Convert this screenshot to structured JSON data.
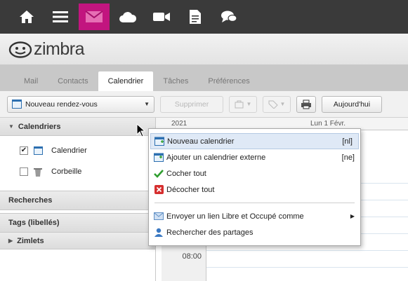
{
  "appbar": {
    "apps": [
      {
        "name": "home-icon"
      },
      {
        "name": "menu-icon"
      },
      {
        "name": "mail-icon",
        "active": true
      },
      {
        "name": "cloud-icon"
      },
      {
        "name": "video-icon"
      },
      {
        "name": "document-icon"
      },
      {
        "name": "chat-icon"
      }
    ],
    "active_color": "#c2157f",
    "bg_color": "#3a3a3a"
  },
  "logo": {
    "text": "zimbra"
  },
  "tabs": [
    {
      "label": "Mail"
    },
    {
      "label": "Contacts"
    },
    {
      "label": "Calendrier",
      "active": true
    },
    {
      "label": "Tâches"
    },
    {
      "label": "Préférences"
    }
  ],
  "toolbar": {
    "new_appointment_label": "Nouveau rendez-vous",
    "delete_label": "Supprimer",
    "today_label": "Aujourd'hui"
  },
  "sidebar": {
    "calendars_header": "Calendriers",
    "calendars": [
      {
        "label": "Calendrier",
        "checked": true
      },
      {
        "label": "Corbeille",
        "checked": false
      }
    ],
    "searches_header": "Recherches",
    "tags_header": "Tags (libellés)",
    "zimlets_header": "Zimlets"
  },
  "calendar": {
    "day_header": "Lun 1 Févr.",
    "year_fragment": "2021",
    "time_label": "08:00"
  },
  "context_menu": {
    "items": [
      {
        "label": "Nouveau calendrier",
        "shortcut": "[nl]",
        "icon": "calendar-add-icon",
        "highlighted": true
      },
      {
        "label": "Ajouter un calendrier externe",
        "shortcut": "[ne]",
        "icon": "calendar-external-icon"
      },
      {
        "label": "Cocher tout",
        "icon": "checkmark-icon"
      },
      {
        "label": "Décocher tout",
        "icon": "uncheck-icon"
      }
    ],
    "items2": [
      {
        "label": "Envoyer un lien Libre et Occupé comme",
        "icon": "envelope-icon",
        "submenu": true
      },
      {
        "label": "Rechercher des partages",
        "icon": "users-icon"
      }
    ]
  }
}
